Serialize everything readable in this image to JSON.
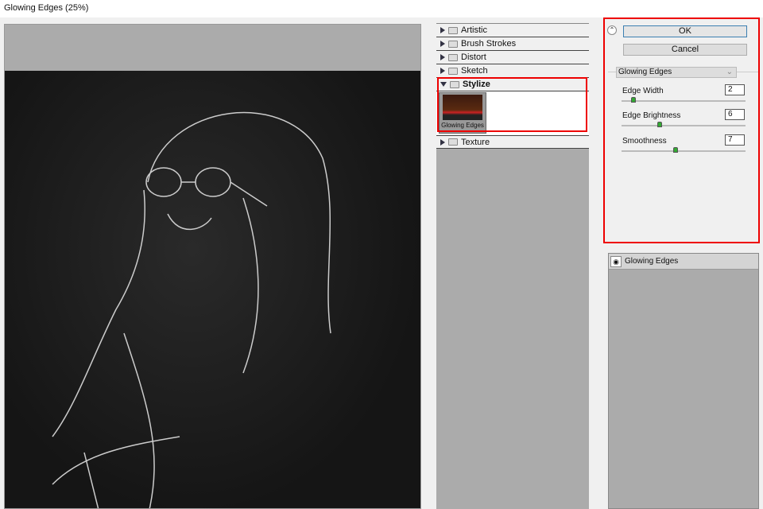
{
  "window": {
    "title": "Glowing Edges (25%)"
  },
  "filter_gallery": {
    "categories": [
      {
        "label": "Artistic",
        "expanded": false
      },
      {
        "label": "Brush Strokes",
        "expanded": false
      },
      {
        "label": "Distort",
        "expanded": false
      },
      {
        "label": "Sketch",
        "expanded": false
      },
      {
        "label": "Stylize",
        "expanded": true
      },
      {
        "label": "Texture",
        "expanded": false
      }
    ],
    "selected_thumb": "Glowing Edges"
  },
  "settings": {
    "ok_label": "OK",
    "cancel_label": "Cancel",
    "filter_select": "Glowing Edges",
    "params": [
      {
        "label": "Edge Width",
        "value": "2",
        "fraction": 0.08
      },
      {
        "label": "Edge Brightness",
        "value": "6",
        "fraction": 0.3
      },
      {
        "label": "Smoothness",
        "value": "7",
        "fraction": 0.43
      }
    ]
  },
  "layers": {
    "items": [
      "Glowing Edges"
    ]
  },
  "colors": {
    "highlight": "#e00000",
    "accent": "#3c7fb1"
  }
}
